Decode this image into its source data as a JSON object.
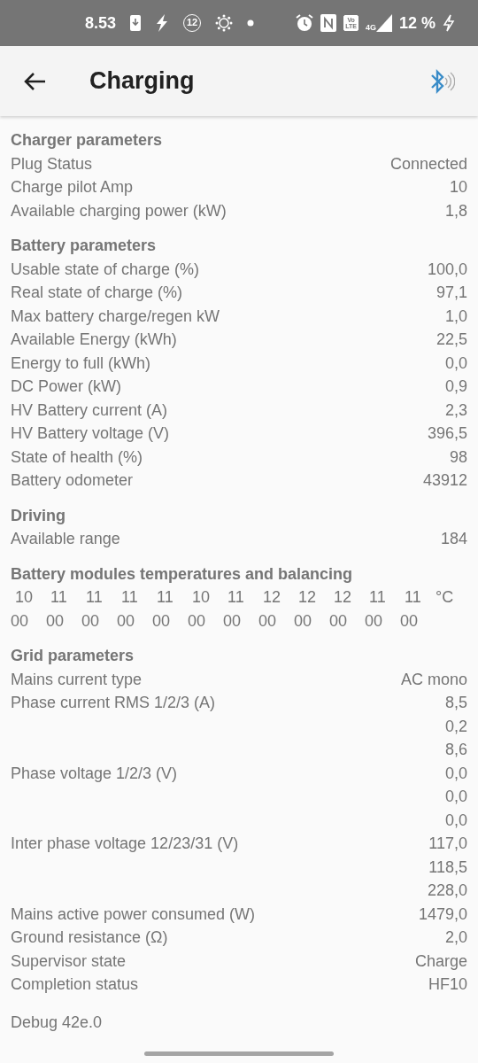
{
  "status_bar": {
    "time": "8.53",
    "notification_count": "12",
    "network": "4G",
    "volte_top": "Vo",
    "volte_bottom": "LTE",
    "battery": "12 %"
  },
  "header": {
    "title": "Charging"
  },
  "sections": [
    {
      "kind": "rows",
      "title": "Charger parameters",
      "rows": [
        {
          "label": "Plug Status",
          "values": [
            "Connected"
          ]
        },
        {
          "label": "Charge pilot Amp",
          "values": [
            "10"
          ]
        },
        {
          "label": "Available charging power (kW)",
          "values": [
            "1,8"
          ]
        }
      ]
    },
    {
      "kind": "rows",
      "title": "Battery parameters",
      "rows": [
        {
          "label": "Usable state of charge (%)",
          "values": [
            "100,0"
          ]
        },
        {
          "label": "Real state of charge (%)",
          "values": [
            "97,1"
          ]
        },
        {
          "label": "Max battery charge/regen kW",
          "values": [
            "1,0"
          ]
        },
        {
          "label": "Available Energy (kWh)",
          "values": [
            "22,5"
          ]
        },
        {
          "label": "Energy to full (kWh)",
          "values": [
            "0,0"
          ]
        },
        {
          "label": "DC Power (kW)",
          "values": [
            "0,9"
          ]
        },
        {
          "label": "HV Battery current (A)",
          "values": [
            "2,3"
          ]
        },
        {
          "label": "HV Battery voltage (V)",
          "values": [
            "396,5"
          ]
        },
        {
          "label": "State of health (%)",
          "values": [
            "98"
          ]
        },
        {
          "label": "Battery odometer",
          "values": [
            "43912"
          ]
        }
      ]
    },
    {
      "kind": "rows",
      "title": "Driving",
      "rows": [
        {
          "label": "Available range",
          "values": [
            "184"
          ]
        }
      ]
    },
    {
      "kind": "modules",
      "title": "Battery modules temperatures and balancing",
      "temperatures": [
        "10",
        "11",
        "11",
        "11",
        "11",
        "10",
        "11",
        "12",
        "12",
        "12",
        "11",
        "11"
      ],
      "unit": "°C",
      "balancing": [
        "00",
        "00",
        "00",
        "00",
        "00",
        "00",
        "00",
        "00",
        "00",
        "00",
        "00",
        "00"
      ]
    },
    {
      "kind": "rows",
      "title": "Grid parameters",
      "rows": [
        {
          "label": "Mains current type",
          "values": [
            "AC mono"
          ]
        },
        {
          "label": "Phase current RMS 1/2/3 (A)",
          "values": [
            "8,5",
            "0,2",
            "8,6"
          ]
        },
        {
          "label": "Phase voltage 1/2/3 (V)",
          "values": [
            "0,0",
            "0,0",
            "0,0"
          ]
        },
        {
          "label": "Inter phase voltage 12/23/31 (V)",
          "values": [
            "117,0",
            "118,5",
            "228,0"
          ]
        },
        {
          "label": "Mains active power consumed (W)",
          "values": [
            "1479,0"
          ]
        },
        {
          "label": "Ground resistance (Ω)",
          "values": [
            "2,0"
          ]
        },
        {
          "label": "Supervisor state",
          "values": [
            "Charge"
          ]
        },
        {
          "label": "Completion status",
          "values": [
            "HF10"
          ]
        }
      ]
    }
  ],
  "footer": {
    "debug": "Debug 42e.0"
  }
}
